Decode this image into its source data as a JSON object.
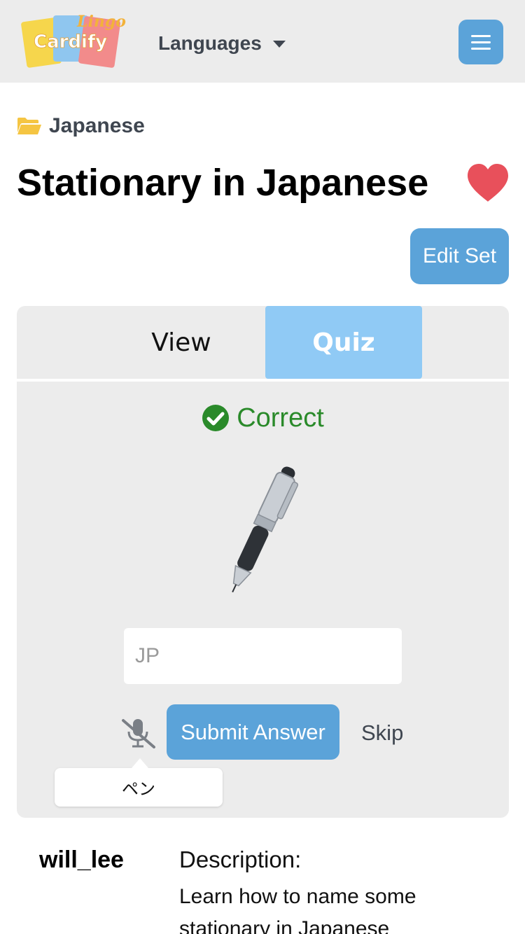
{
  "header": {
    "logo_alt_text": "Lingo Cardify",
    "languages_label": "Languages",
    "icons": {
      "caret": "chevron-down-icon",
      "menu": "hamburger-menu-icon"
    },
    "accent_color": "#5ba3d9"
  },
  "category": {
    "label": "Japanese",
    "icon": "folder-open-icon",
    "icon_color": "#f5c542"
  },
  "set": {
    "title": "Stationary in Japanese",
    "favorite_icon": "heart-icon",
    "favorite_color": "#e8505b",
    "edit_label": "Edit Set"
  },
  "tabs": [
    {
      "label": "View",
      "active": false
    },
    {
      "label": "Quiz",
      "active": true
    }
  ],
  "quiz": {
    "result_text": "Correct",
    "result_icon": "check-circle-icon",
    "result_color": "#2a8a2a",
    "image_name": "pen-image",
    "input_value": "",
    "input_placeholder": "JP",
    "mic_icon": "microphone-off-icon",
    "submit_label": "Submit Answer",
    "skip_label": "Skip",
    "answer_tooltip": "ペン"
  },
  "footer": {
    "author": "will_lee",
    "description_label": "Description:",
    "description_text": "Learn how to name some stationary in Japanese"
  }
}
